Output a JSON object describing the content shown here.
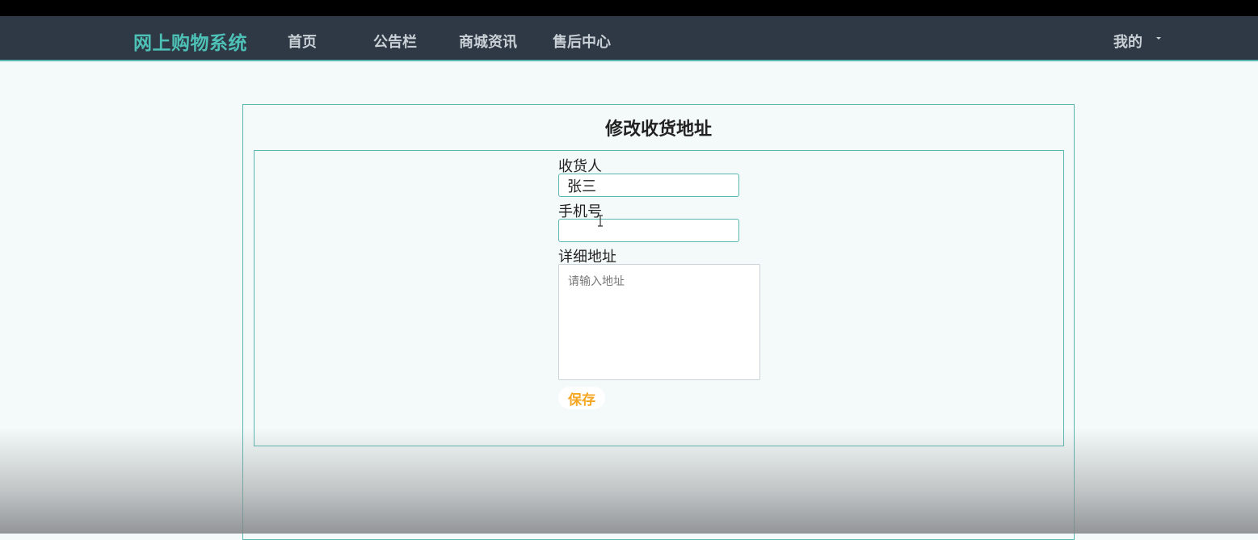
{
  "navbar": {
    "brand": "网上购物系统",
    "items": [
      {
        "label": "首页"
      },
      {
        "label": "公告栏"
      },
      {
        "label": "商城资讯"
      },
      {
        "label": "售后中心"
      }
    ],
    "user_menu": "我的"
  },
  "page": {
    "title": "修改收货地址"
  },
  "form": {
    "receiver_label": "收货人",
    "receiver_value": "张三",
    "phone_label": "手机号",
    "phone_value": "",
    "address_label": "详细地址",
    "address_placeholder": "请输入地址",
    "save_label": "保存"
  },
  "colors": {
    "navbar_bg": "#2e3945",
    "brand": "#4ec1b7",
    "border_accent": "#58b7b0",
    "save_text": "#f5a623"
  }
}
